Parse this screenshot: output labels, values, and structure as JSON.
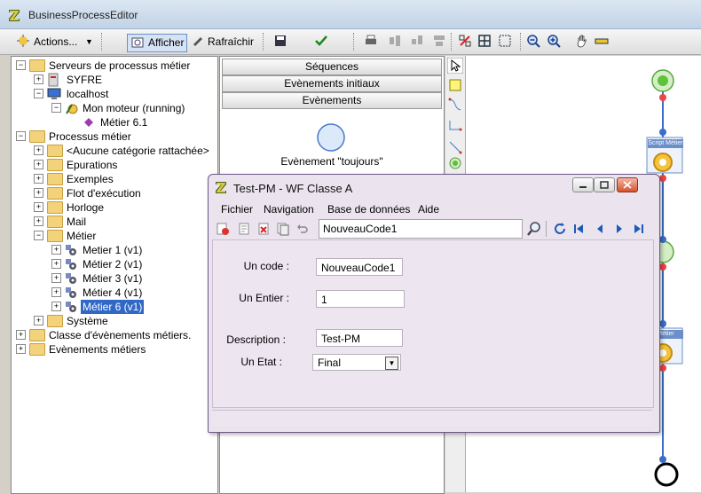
{
  "app": {
    "title": "BusinessProcessEditor"
  },
  "toolbar": {
    "actions_label": "Actions...",
    "afficher_label": "Afficher",
    "rafraichir_label": "Rafraîchir"
  },
  "tree": {
    "servers": "Serveurs de processus métier",
    "syfre": "SYFRE",
    "localhost": "localhost",
    "engine": "Mon moteur (running)",
    "metier61": "Métier 6.1",
    "processus": "Processus métier",
    "no_cat": "<Aucune catégorie rattachée>",
    "epurations": "Epurations",
    "exemples": "Exemples",
    "flot": "Flot d'exécution",
    "horloge": "Horloge",
    "mail": "Mail",
    "metier": "Métier",
    "m1": "Metier 1 (v1)",
    "m2": "Métier 2 (v1)",
    "m3": "Métier 3 (v1)",
    "m4": "Métier 4 (v1)",
    "m6": "Métier 6 (v1)",
    "systeme": "Système",
    "classe_ev": "Classe d'évènements métiers.",
    "ev_metiers": "Evènements métiers"
  },
  "mid": {
    "sequences": "Séquences",
    "ev_initiaux": "Evènements initiaux",
    "evenements": "Evènements",
    "toujours": "Evènement \"toujours\""
  },
  "canvas": {
    "script_label": "Script Métier",
    "metier_label": "Métier"
  },
  "dialog": {
    "title": "Test-PM -  WF Classe A",
    "menu": {
      "fichier": "Fichier",
      "navigation": "Navigation",
      "bdd": "Base de données",
      "aide": "Aide"
    },
    "code_value": "NouveauCode1",
    "fields": {
      "code_label": "Un code :",
      "code_value": "NouveauCode1",
      "entier_label": "Un Entier :",
      "entier_value": "1",
      "desc_label": "Description :",
      "desc_value": "Test-PM",
      "etat_label": "Un Etat :",
      "etat_value": "Final"
    }
  }
}
